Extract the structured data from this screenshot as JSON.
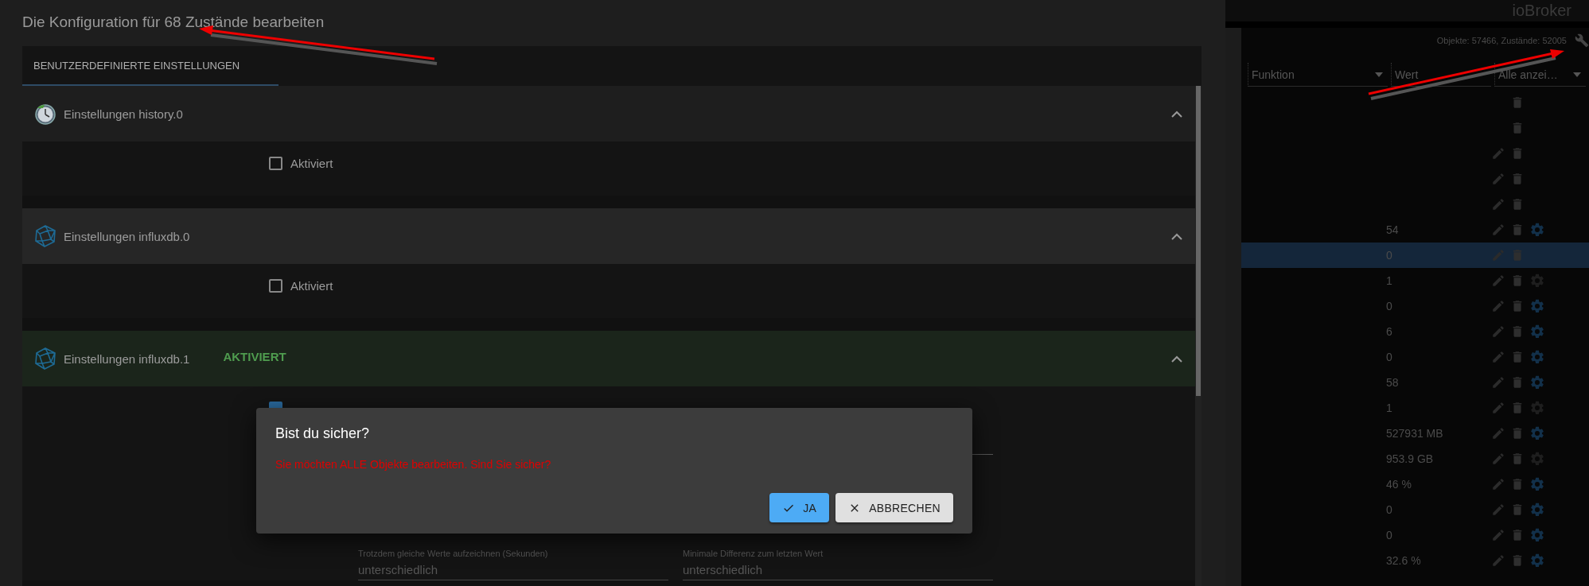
{
  "dialog": {
    "title": "Die Konfiguration für 68 Zustände bearbeiten",
    "tabs": [
      {
        "label": "BENUTZERDEFINIERTE EINSTELLUNGEN",
        "selected": true
      }
    ],
    "sections": [
      {
        "kind": "clock",
        "title": "Einstellungen history.0",
        "expanded": true,
        "enabled": {
          "label": "Aktiviert",
          "checked": false
        }
      },
      {
        "kind": "polyhedron",
        "title": "Einstellungen influxdb.0",
        "expanded": true,
        "enabled": {
          "label": "Aktiviert",
          "checked": false
        }
      },
      {
        "kind": "polyhedron",
        "title": "Einstellungen influxdb.1",
        "expanded": true,
        "badge": "AKTIVIERT",
        "enabled": {
          "checked": true
        },
        "fields": [
          {
            "label": "Trotzdem gleiche Werte aufzeichnen (Sekunden)",
            "value": "unterschiedlich"
          },
          {
            "label": "Minimale Differenz zum letzten Wert",
            "value": "unterschiedlich"
          }
        ]
      }
    ]
  },
  "confirm": {
    "title": "Bist du sicher?",
    "message": "Sie möchten ALLE Objekte bearbeiten. Sind Sie sicher?",
    "buttons": [
      {
        "kind": "primary",
        "label": "JA"
      },
      {
        "kind": "secondary",
        "label": "ABBRECHEN"
      }
    ]
  },
  "background": {
    "app_title": "ioBroker",
    "stats": "Objekte: 57466, Zustände: 52005",
    "columns": [
      {
        "label": "Funktion",
        "dropdown": true
      },
      {
        "label": "Wert",
        "dropdown": false
      },
      {
        "label": "Alle anzei…",
        "dropdown": true
      }
    ],
    "rows": [
      {
        "editable": false,
        "gear": false,
        "selected": false
      },
      {
        "editable": false,
        "gear": false,
        "selected": false
      },
      {
        "editable": true,
        "gear": false,
        "selected": false
      },
      {
        "editable": true,
        "gear": false,
        "selected": false
      },
      {
        "editable": true,
        "gear": false,
        "selected": false
      },
      {
        "value": "54",
        "editable": true,
        "gear": true,
        "gear_enabled": true,
        "selected": false
      },
      {
        "value": "0",
        "editable": true,
        "gear": false,
        "selected": true
      },
      {
        "value": "1",
        "editable": true,
        "gear": true,
        "gear_enabled": false,
        "selected": false
      },
      {
        "value": "0",
        "editable": true,
        "gear": true,
        "gear_enabled": true,
        "selected": false
      },
      {
        "value": "6",
        "editable": true,
        "gear": true,
        "gear_enabled": true,
        "selected": false
      },
      {
        "value": "0",
        "editable": true,
        "gear": true,
        "gear_enabled": true,
        "selected": false
      },
      {
        "value": "58",
        "editable": true,
        "gear": true,
        "gear_enabled": true,
        "selected": false
      },
      {
        "value": "1",
        "editable": true,
        "gear": true,
        "gear_enabled": false,
        "selected": false
      },
      {
        "value": "527931 MB",
        "editable": true,
        "gear": true,
        "gear_enabled": true,
        "selected": false
      },
      {
        "value": "953.9 GB",
        "editable": true,
        "gear": true,
        "gear_enabled": false,
        "selected": false
      },
      {
        "value": "46 %",
        "editable": true,
        "gear": true,
        "gear_enabled": true,
        "selected": false
      },
      {
        "value": "0",
        "editable": true,
        "gear": true,
        "gear_enabled": true,
        "selected": false
      },
      {
        "value": "0",
        "editable": true,
        "gear": true,
        "gear_enabled": true,
        "selected": false
      },
      {
        "value": "32.6 %",
        "editable": true,
        "gear": true,
        "gear_enabled": true,
        "selected": false
      }
    ]
  }
}
